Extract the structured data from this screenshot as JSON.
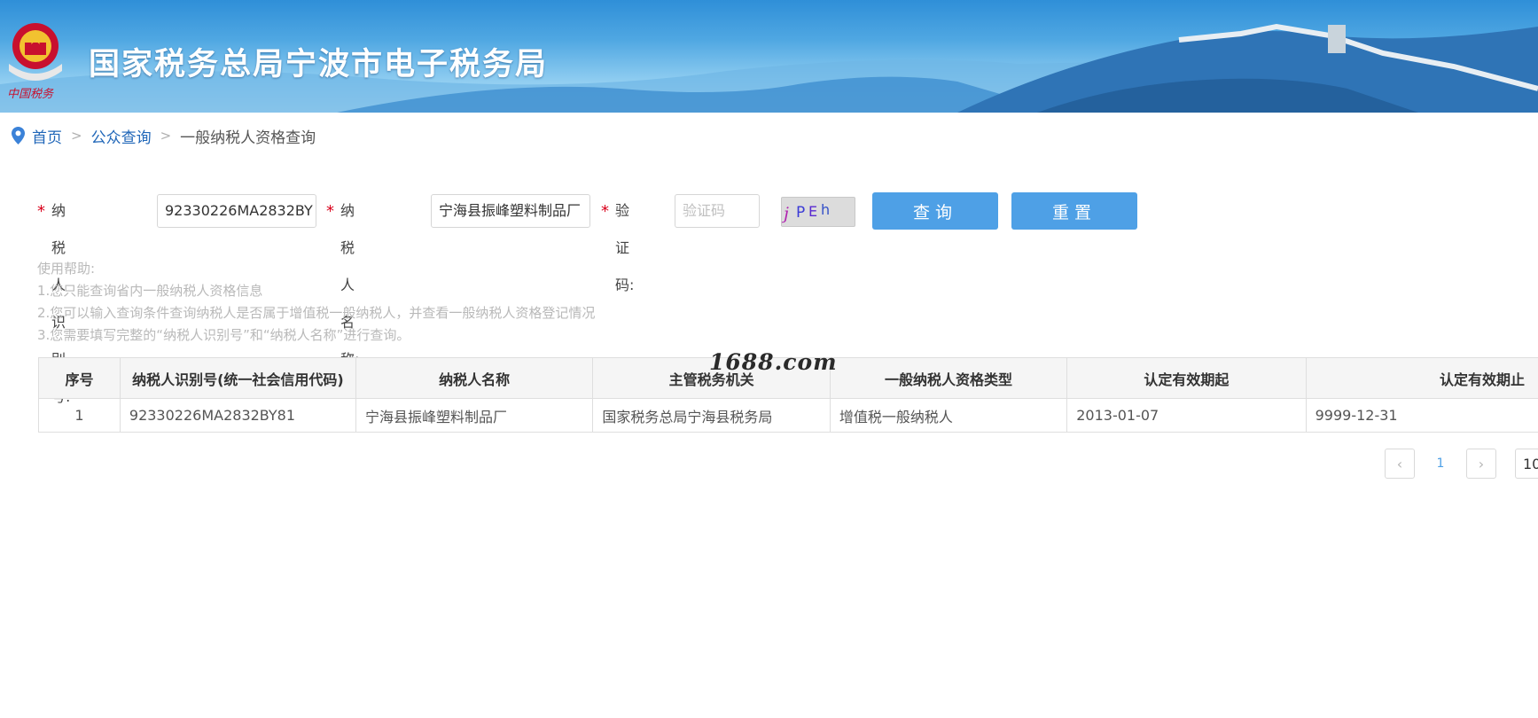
{
  "header": {
    "site_title": "国家税务总局宁波市电子税务局",
    "emblem_caption": "中国税务"
  },
  "breadcrumb": {
    "home": "首页",
    "public_query": "公众查询",
    "current": "一般纳税人资格查询",
    "separator": ">"
  },
  "form": {
    "required_mark": "*",
    "taxpayer_id_label": "纳税人识别号:",
    "taxpayer_id_value": "92330226MA2832BY",
    "taxpayer_name_label": "纳税人名称:",
    "taxpayer_name_value": "宁海县振峰塑料制品厂",
    "captcha_label": "验证码:",
    "captcha_placeholder": "验证码",
    "captcha_text": "jPEh",
    "query_button": "查询",
    "reset_button": "重置"
  },
  "help": {
    "title": "使用帮助:",
    "lines": [
      "1.您只能查询省内一般纳税人资格信息",
      "2.您可以输入查询条件查询纳税人是否属于增值税一般纳税人，并查看一般纳税人资格登记情况",
      "3.您需要填写完整的“纳税人识别号”和“纳税人名称”进行查询。"
    ]
  },
  "watermark": "1688.com",
  "table": {
    "columns": [
      "序号",
      "纳税人识别号(统一社会信用代码)",
      "纳税人名称",
      "主管税务机关",
      "一般纳税人资格类型",
      "认定有效期起",
      "认定有效期止"
    ],
    "rows": [
      [
        "1",
        "92330226MA2832BY81",
        "宁海县振峰塑料制品厂",
        "国家税务总局宁海县税务局",
        "增值税一般纳税人",
        "2013-01-07",
        "9999-12-31"
      ]
    ]
  },
  "pagination": {
    "prev": "‹",
    "current_page": "1",
    "next": "›",
    "page_size": "10"
  },
  "colors": {
    "primary_button": "#4ea0e6",
    "link": "#1f66b8",
    "required": "#d9001b"
  },
  "icons": [
    "location-pin-icon",
    "national-tax-emblem",
    "chevron-left-icon",
    "chevron-right-icon"
  ]
}
